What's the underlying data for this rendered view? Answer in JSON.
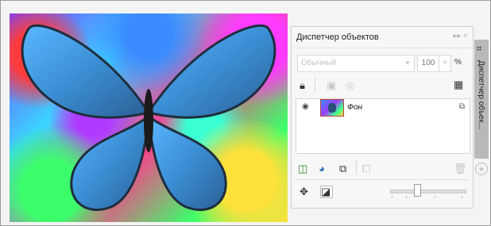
{
  "canvas": {
    "image_name": "butterfly-image"
  },
  "panel": {
    "title": "Диспетчер объектов",
    "header_icons": "▸▸ ×",
    "blend_mode": {
      "value": "Обычный"
    },
    "opacity": {
      "value": "100",
      "unit": "%"
    },
    "stepper_symbol": "+",
    "layers": [
      {
        "name": "Фон"
      }
    ]
  },
  "side_tab": {
    "label": "Диспетчер объек..."
  },
  "icons": {
    "add": "+"
  }
}
